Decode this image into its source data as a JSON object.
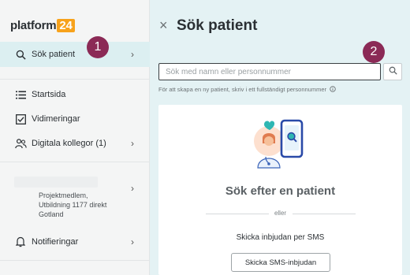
{
  "sidebar": {
    "logo": {
      "text": "platform",
      "badge": "24"
    },
    "items": [
      {
        "label": "Sök patient",
        "icon": "search-icon"
      },
      {
        "label": "Startsida",
        "icon": "list-icon"
      },
      {
        "label": "Vidimeringar",
        "icon": "checkbox-icon"
      },
      {
        "label": "Digitala kollegor (1)",
        "icon": "people-icon"
      },
      {
        "label_lines": [
          "Projektmedlem,",
          "Utbildning 1177 direkt",
          "Gotland"
        ]
      },
      {
        "label": "Notifieringar",
        "icon": "bell-icon"
      }
    ]
  },
  "step_badges": [
    "1",
    "2"
  ],
  "panel": {
    "close": "×",
    "title": "Sök patient",
    "search": {
      "placeholder": "Sök med namn eller personnummer"
    },
    "hint": "För att skapa en ny patient, skriv i ett fullständigt personnummer",
    "card": {
      "title": "Sök efter en patient",
      "or": "eller",
      "sms_label": "Skicka inbjudan per SMS",
      "sms_button": "Skicka SMS-inbjudan"
    }
  },
  "colors": {
    "accent": "#8b2a56",
    "active_bg": "#dceff1",
    "brand_badge": "#f7a21b",
    "panel_bg": "#e4f2f4"
  }
}
